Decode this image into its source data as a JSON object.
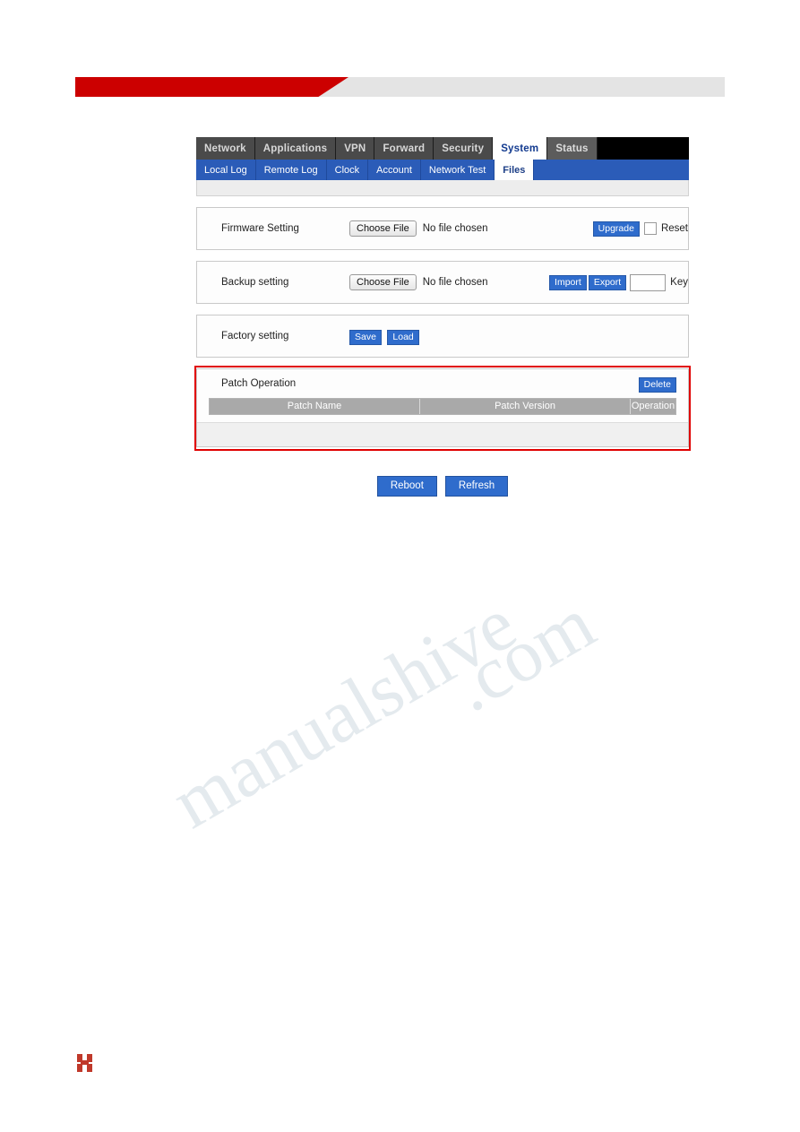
{
  "nav": {
    "tabs": [
      {
        "label": "Network",
        "active": false
      },
      {
        "label": "Applications",
        "active": false
      },
      {
        "label": "VPN",
        "active": false
      },
      {
        "label": "Forward",
        "active": false
      },
      {
        "label": "Security",
        "active": false
      },
      {
        "label": "System",
        "active": true
      },
      {
        "label": "Status",
        "active": false
      }
    ]
  },
  "subnav": {
    "tabs": [
      {
        "label": "Local Log",
        "active": false
      },
      {
        "label": "Remote Log",
        "active": false
      },
      {
        "label": "Clock",
        "active": false
      },
      {
        "label": "Account",
        "active": false
      },
      {
        "label": "Network Test",
        "active": false
      },
      {
        "label": "Files",
        "active": true
      }
    ]
  },
  "firmware": {
    "label": "Firmware Setting",
    "choose_file": "Choose File",
    "file_status": "No file chosen",
    "upgrade_label": "Upgrade",
    "reset_label": "Reset"
  },
  "backup": {
    "label": "Backup setting",
    "choose_file": "Choose File",
    "file_status": "No file chosen",
    "import_label": "Import",
    "export_label": "Export",
    "key_value": "",
    "key_label": "Key"
  },
  "factory": {
    "label": "Factory setting",
    "save_label": "Save",
    "load_label": "Load"
  },
  "patch": {
    "title": "Patch Operation",
    "delete_label": "Delete",
    "columns": [
      "Patch Name",
      "Patch Version",
      "Operation"
    ],
    "rows": []
  },
  "footer": {
    "reboot_label": "Reboot",
    "refresh_label": "Refresh"
  },
  "watermark": {
    "line1": "manualshive",
    "line2": ".com"
  },
  "colors": {
    "accent_blue": "#2f6ccc",
    "nav_dark": "#4a4a4a",
    "subnav_blue": "#2b5cb8",
    "banner_red": "#cc0000",
    "highlight_red": "#e00000"
  }
}
